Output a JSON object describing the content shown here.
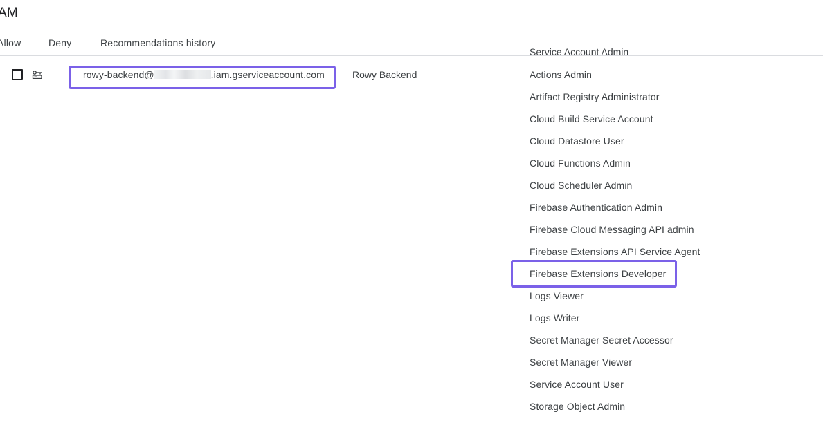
{
  "header": {
    "title": "AM"
  },
  "tabs": [
    {
      "label": "Allow"
    },
    {
      "label": "Deny"
    },
    {
      "label": "Recommendations history"
    }
  ],
  "table": {
    "clipped_role_above": "Service Account Admin",
    "row": {
      "principal_prefix": "rowy-backend@",
      "principal_suffix": ".iam.gserviceaccount.com",
      "name": "Rowy Backend",
      "roles": [
        "Actions Admin",
        "Artifact Registry Administrator",
        "Cloud Build Service Account",
        "Cloud Datastore User",
        "Cloud Functions Admin",
        "Cloud Scheduler Admin",
        "Firebase Authentication Admin",
        "Firebase Cloud Messaging API admin",
        "Firebase Extensions API Service Agent",
        "Firebase Extensions Developer",
        "Logs Viewer",
        "Logs Writer",
        "Secret Manager Secret Accessor",
        "Secret Manager Viewer",
        "Service Account User",
        "Storage Object Admin"
      ]
    }
  },
  "colors": {
    "highlight": "#7b61e8",
    "text": "#3c4043",
    "divider": "#dadce0"
  },
  "icons": {
    "row_type": "service-account-icon"
  }
}
